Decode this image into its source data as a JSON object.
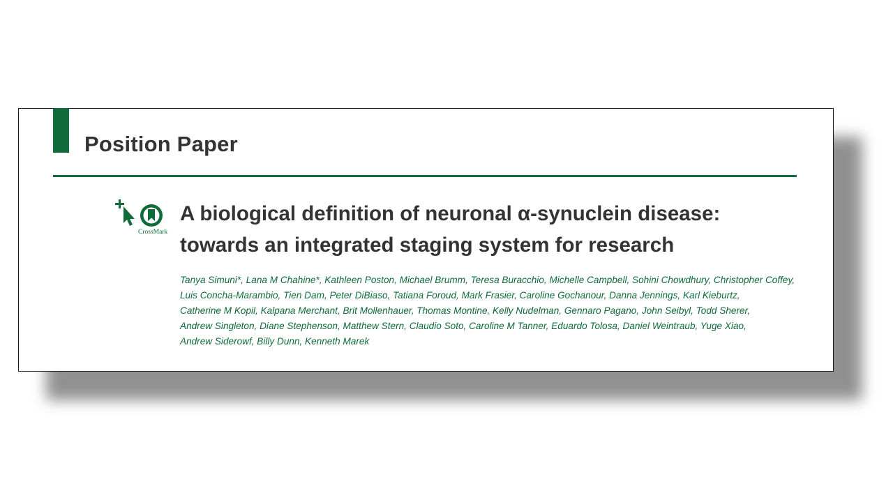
{
  "paper": {
    "section_label": "Position Paper",
    "crossmark_label": "CrossMark",
    "title_lines": [
      "A biological definition of neuronal α-synuclein disease:",
      "towards an integrated staging system for research"
    ],
    "author_lines": [
      "Tanya Simuni*, Lana M Chahine*, Kathleen Poston, Michael Brumm, Teresa Buracchio, Michelle Campbell, Sohini Chowdhury, Christopher Coffey,",
      "Luis Concha-Marambio, Tien Dam, Peter DiBiaso, Tatiana Foroud, Mark Frasier, Caroline Gochanour, Danna Jennings, Karl Kieburtz,",
      "Catherine M Kopil, Kalpana Merchant, Brit Mollenhauer, Thomas Montine, Kelly Nudelman, Gennaro Pagano, John Seibyl, Todd Sherer,",
      "Andrew Singleton, Diane Stephenson, Matthew Stern, Claudio Soto, Caroline M Tanner, Eduardo Tolosa, Daniel Weintraub, Yuge Xiao,",
      "Andrew Siderowf, Billy Dunn, Kenneth Marek"
    ]
  },
  "colors": {
    "accent_green": "#0f6b3a",
    "heading_gray": "#333333"
  },
  "icons": {
    "crossmark": "crossmark-icon"
  }
}
